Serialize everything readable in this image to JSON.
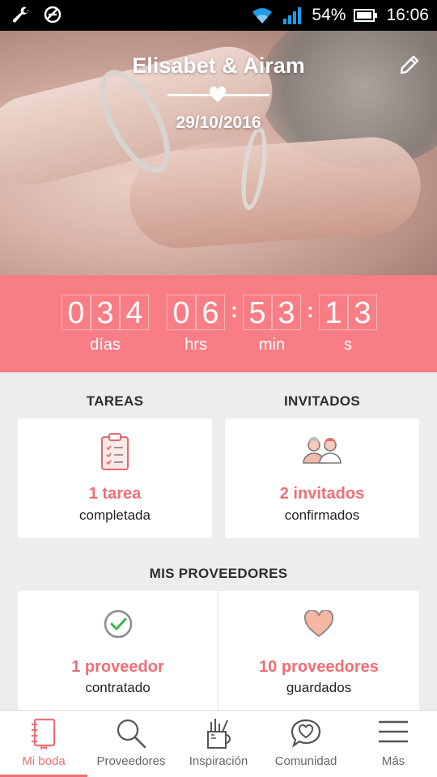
{
  "status_bar": {
    "battery": "54%",
    "time": "16:06"
  },
  "hero": {
    "couple_names": "Elisabet & Airam",
    "wedding_date": "29/10/2016"
  },
  "countdown": {
    "days": [
      "0",
      "3",
      "4"
    ],
    "hours": [
      "0",
      "6"
    ],
    "minutes": [
      "5",
      "3"
    ],
    "seconds": [
      "1",
      "3"
    ],
    "labels": {
      "days": "días",
      "hours": "hrs",
      "minutes": "min",
      "seconds": "s"
    },
    "separator": ":"
  },
  "tasks": {
    "heading": "TAREAS",
    "value": "1 tarea",
    "subtitle": "completada"
  },
  "guests": {
    "heading": "INVITADOS",
    "value": "2 invitados",
    "subtitle": "confirmados"
  },
  "vendors": {
    "heading": "MIS PROVEEDORES",
    "hired": {
      "value": "1 proveedor",
      "subtitle": "contratado"
    },
    "saved": {
      "value": "10 proveedores",
      "subtitle": "guardados"
    }
  },
  "bottom_nav": {
    "items": [
      {
        "label": "Mi boda",
        "active": true
      },
      {
        "label": "Proveedores"
      },
      {
        "label": "Inspiración"
      },
      {
        "label": "Comunidad"
      },
      {
        "label": "Más"
      }
    ]
  },
  "colors": {
    "accent": "#ee6f75",
    "countdown_bg": "#f87d84",
    "page_bg": "#ededed"
  }
}
